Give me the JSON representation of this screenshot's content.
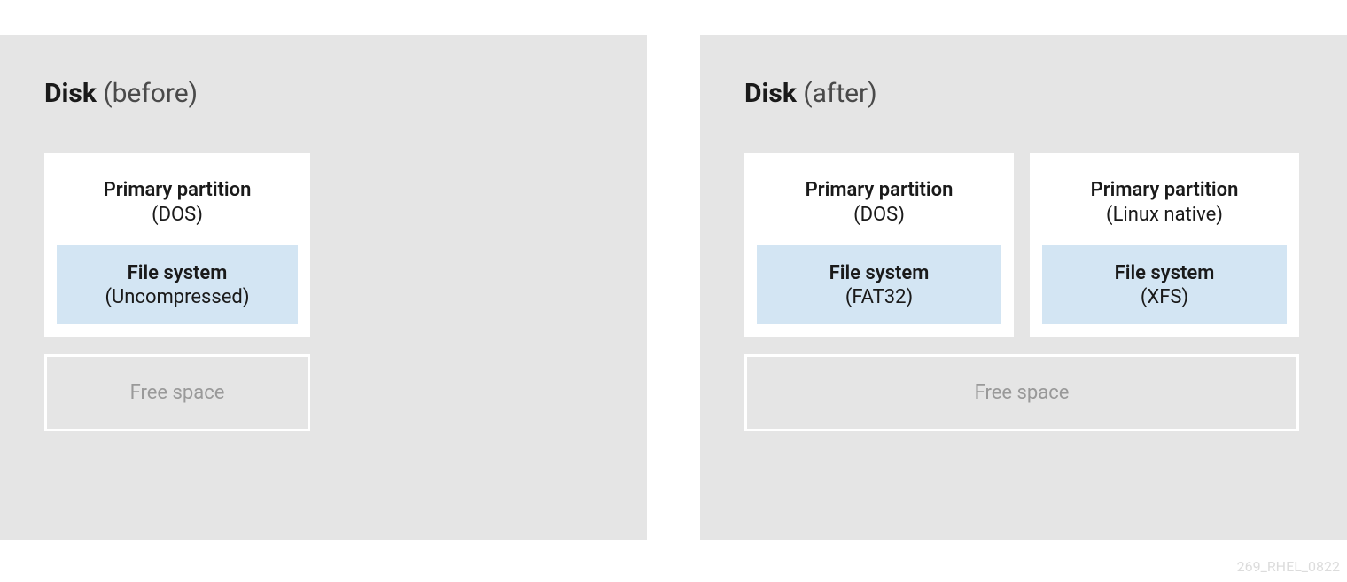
{
  "before": {
    "title_bold": "Disk",
    "title_light": " (before)",
    "partition": {
      "label": "Primary partition",
      "type": "(DOS)",
      "filesystem_label": "File system",
      "filesystem_type": "(Uncompressed)"
    },
    "free_space": "Free space"
  },
  "after": {
    "title_bold": "Disk",
    "title_light": " (after)",
    "partition1": {
      "label": "Primary partition",
      "type": "(DOS)",
      "filesystem_label": "File system",
      "filesystem_type": "(FAT32)"
    },
    "partition2": {
      "label": "Primary partition",
      "type": "(Linux native)",
      "filesystem_label": "File system",
      "filesystem_type": "(XFS)"
    },
    "free_space": "Free space"
  },
  "watermark": "269_RHEL_0822"
}
